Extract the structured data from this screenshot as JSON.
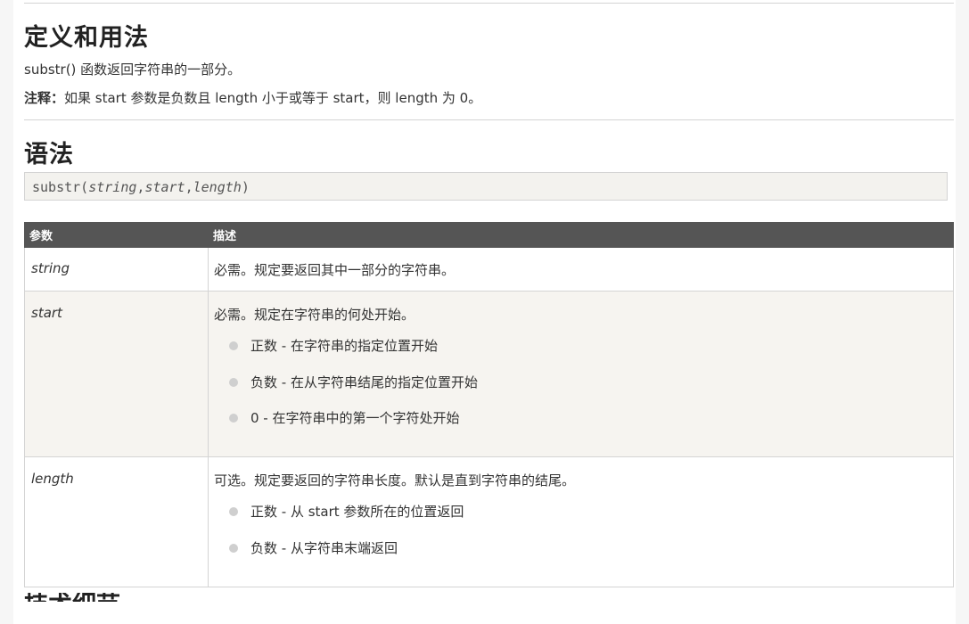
{
  "definition": {
    "heading": "定义和用法",
    "description": "substr() 函数返回字符串的一部分。",
    "note_label": "注释：",
    "note_text": "如果 start 参数是负数且 length 小于或等于 start，则 length 为 0。"
  },
  "syntax": {
    "heading": "语法",
    "code_func": "substr(",
    "code_p1": "string",
    "code_sep1": ",",
    "code_p2": "start",
    "code_sep2": ",",
    "code_p3": "length",
    "code_close": ")"
  },
  "table": {
    "headers": [
      "参数",
      "描述"
    ],
    "rows": [
      {
        "param": "string",
        "desc": "必需。规定要返回其中一部分的字符串。",
        "bullets": []
      },
      {
        "param": "start",
        "desc": "必需。规定在字符串的何处开始。",
        "bullets": [
          "正数 - 在字符串的指定位置开始",
          "负数 - 在从字符串结尾的指定位置开始",
          "0 - 在字符串中的第一个字符处开始"
        ]
      },
      {
        "param": "length",
        "desc": "可选。规定要返回的字符串长度。默认是直到字符串的结尾。",
        "bullets": [
          "正数 - 从 start 参数所在的位置返回",
          "负数 - 从字符串末端返回"
        ]
      }
    ]
  },
  "next_heading_partial": "技术细节"
}
